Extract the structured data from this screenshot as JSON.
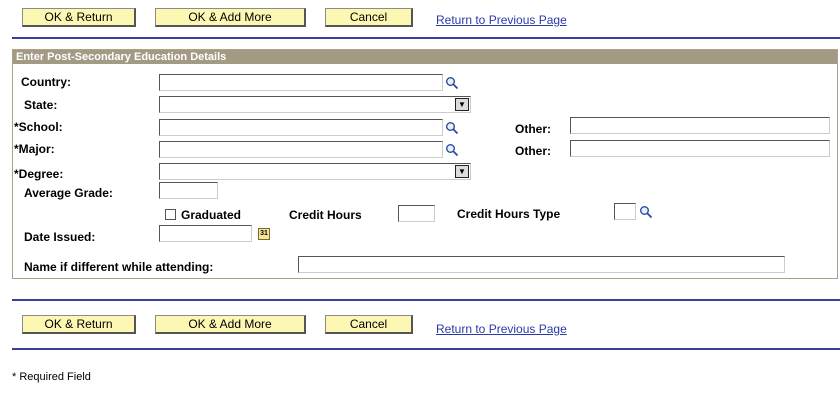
{
  "toolbar_top": {
    "ok_return": "OK & Return",
    "ok_add_more": "OK & Add More",
    "cancel": "Cancel",
    "return_link": "Return to Previous Page"
  },
  "section": {
    "title": "Enter Post-Secondary Education Details"
  },
  "form": {
    "country_label": "Country:",
    "country_value": "",
    "state_label": "State:",
    "state_value": "",
    "school_label": "*School:",
    "school_value": "",
    "school_other_label": "Other:",
    "school_other_value": "",
    "major_label": "*Major:",
    "major_value": "",
    "major_other_label": "Other:",
    "major_other_value": "",
    "degree_label": "*Degree:",
    "degree_value": "",
    "average_grade_label": "Average Grade:",
    "average_grade_value": "",
    "graduated_label": "Graduated",
    "graduated_checked": false,
    "credit_hours_label": "Credit Hours",
    "credit_hours_value": "",
    "credit_hours_type_label": "Credit Hours Type",
    "credit_hours_type_value": "",
    "date_issued_label": "Date Issued:",
    "date_issued_value": "",
    "calendar_glyph": "31",
    "name_different_label": "Name if different while attending:",
    "name_different_value": ""
  },
  "toolbar_bottom": {
    "ok_return": "OK & Return",
    "ok_add_more": "OK & Add More",
    "cancel": "Cancel",
    "return_link": "Return to Previous Page"
  },
  "footer": {
    "required_note": "* Required Field"
  },
  "icons": {
    "lookup": "magnifier-icon",
    "dropdown": "chevron-down-icon",
    "calendar": "calendar-icon"
  },
  "colors": {
    "button_bg": "#fdf7b4",
    "link": "#2a3aa8",
    "rule": "#3c3f96",
    "section_header": "#a39a84"
  }
}
